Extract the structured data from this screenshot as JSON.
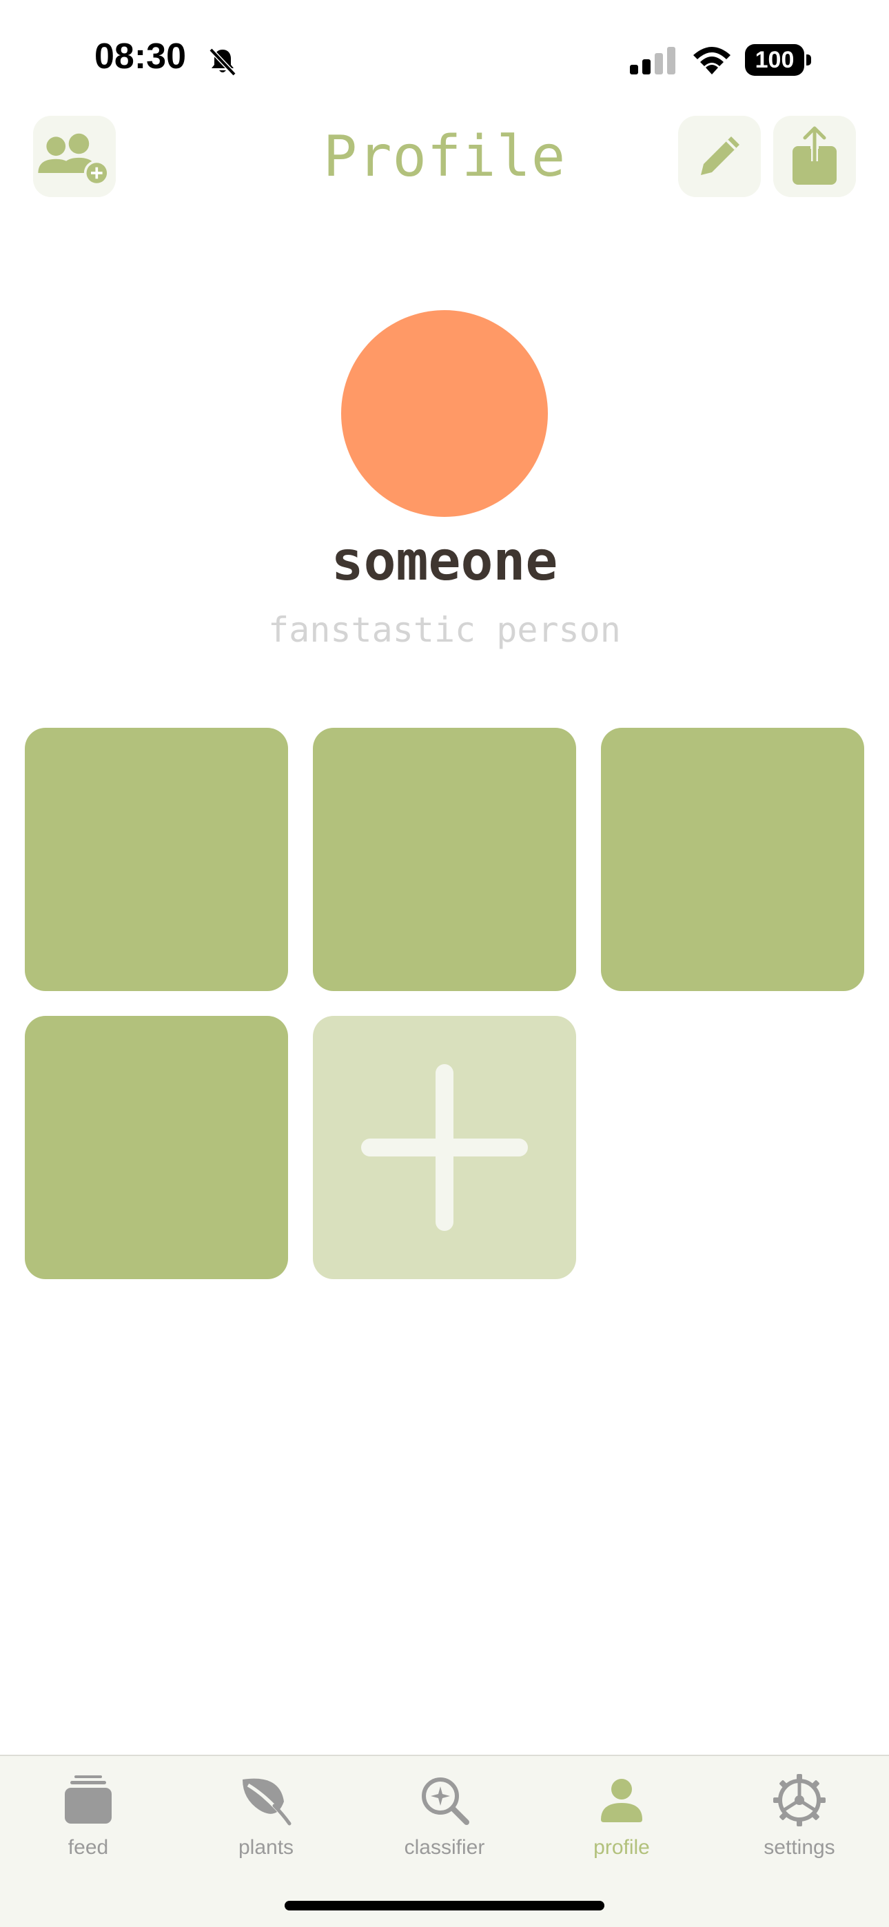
{
  "status_bar": {
    "time": "08:30",
    "battery": "100"
  },
  "header": {
    "title": "Profile",
    "left_button_icon": "add-friend-icon",
    "right_buttons": [
      "edit-icon",
      "share-icon"
    ]
  },
  "profile": {
    "name": "someone",
    "bio": "fanstastic person",
    "avatar_color": "#ff9966"
  },
  "plants_grid": {
    "tile_count": 4,
    "tile_color": "#b2c17c",
    "add_tile_color": "#d9e0bd"
  },
  "tabbar": {
    "items": [
      {
        "label": "feed",
        "icon": "feed-icon",
        "active": false
      },
      {
        "label": "plants",
        "icon": "leaf-icon",
        "active": false
      },
      {
        "label": "classifier",
        "icon": "sparkle-search-icon",
        "active": false
      },
      {
        "label": "profile",
        "icon": "person-icon",
        "active": true
      },
      {
        "label": "settings",
        "icon": "gear-icon",
        "active": false
      }
    ]
  },
  "colors": {
    "accent": "#b2c17c",
    "inactive": "#9a9a9a"
  }
}
